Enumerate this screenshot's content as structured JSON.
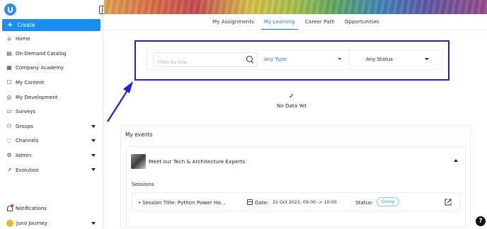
{
  "sidebar": {
    "create_label": "Create",
    "items": [
      {
        "label": "Home",
        "icon": "home-icon",
        "glyph": "⌂",
        "has_caret": false
      },
      {
        "label": "On-Demand Catalog",
        "icon": "catalog-icon",
        "glyph": "▤",
        "has_caret": false
      },
      {
        "label": "Company Academy",
        "icon": "grid-icon",
        "glyph": "▦",
        "has_caret": false
      },
      {
        "label": "My Content",
        "icon": "content-icon",
        "glyph": "☐",
        "has_caret": false
      },
      {
        "label": "My Development",
        "icon": "development-icon",
        "glyph": "◎",
        "has_caret": false
      },
      {
        "label": "Surveys",
        "icon": "survey-icon",
        "glyph": "▭",
        "has_caret": false
      },
      {
        "label": "Groups",
        "icon": "groups-icon",
        "glyph": "⚇",
        "has_caret": true
      },
      {
        "label": "Channels",
        "icon": "channels-icon",
        "glyph": "◌",
        "has_caret": true
      },
      {
        "label": "Admin",
        "icon": "admin-icon",
        "glyph": "⚙",
        "has_caret": true
      },
      {
        "label": "Evolution",
        "icon": "evolution-icon",
        "glyph": "↗",
        "has_caret": true
      }
    ],
    "notifications_label": "Notifications",
    "user_name": "Juno Journey"
  },
  "tabs": [
    {
      "label": "My Assignments",
      "active": false
    },
    {
      "label": "My Learning",
      "active": true
    },
    {
      "label": "Career Path",
      "active": false
    },
    {
      "label": "Opportunities",
      "active": false
    }
  ],
  "filters": {
    "search_placeholder": "Filter by title",
    "type_value": "Any Type",
    "status_value": "Any Status"
  },
  "empty_state": {
    "message": "No Data Yet"
  },
  "events": {
    "title": "My events",
    "event_name": "Meet our Tech & Architecture Experts",
    "sessions_label": "Sessions",
    "session": {
      "title_label": "Session Title:",
      "title_value": "Python Power Ho...",
      "date_label": "Date:",
      "date_value": "31 Oct 2023, 09:00 -> 10:00",
      "status_label": "Status:",
      "status_value": "Going"
    }
  },
  "colors": {
    "accent": "#1a8ef0",
    "highlight_border": "#1f1fd6",
    "status_going": "#3aa896"
  }
}
